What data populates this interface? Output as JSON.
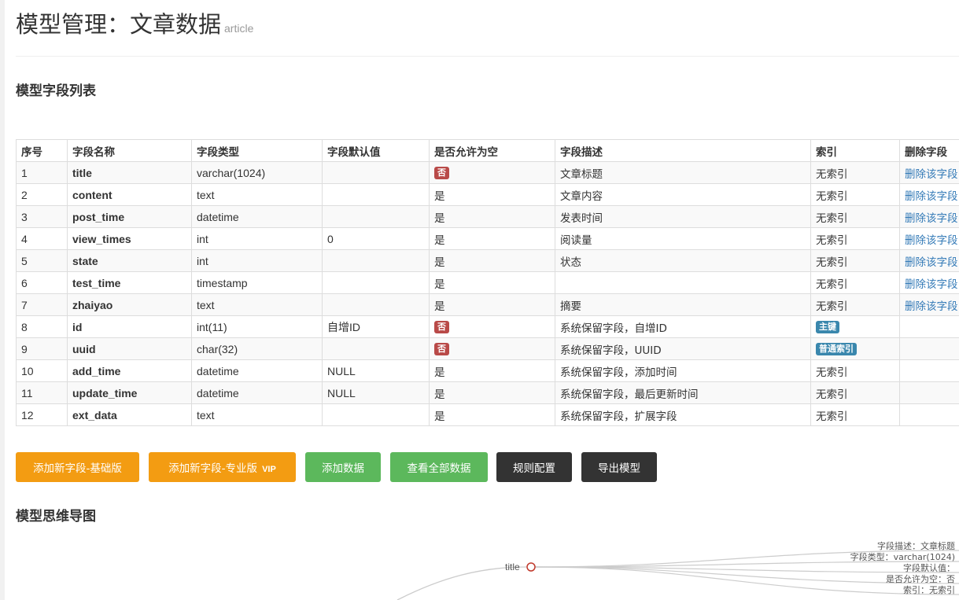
{
  "header": {
    "title": "模型管理：文章数据",
    "subtitle": "article"
  },
  "fields_section": {
    "title": "模型字段列表"
  },
  "table": {
    "columns": [
      "序号",
      "字段名称",
      "字段类型",
      "字段默认值",
      "是否允许为空",
      "字段描述",
      "索引",
      "删除字段"
    ],
    "rows": [
      {
        "no": "1",
        "name": "title",
        "type": "varchar(1024)",
        "default": "",
        "nullable": "否",
        "desc": "文章标题",
        "index": "无索引",
        "delete": "删除该字段"
      },
      {
        "no": "2",
        "name": "content",
        "type": "text",
        "default": "",
        "nullable": "是",
        "desc": "文章内容",
        "index": "无索引",
        "delete": "删除该字段"
      },
      {
        "no": "3",
        "name": "post_time",
        "type": "datetime",
        "default": "",
        "nullable": "是",
        "desc": "发表时间",
        "index": "无索引",
        "delete": "删除该字段"
      },
      {
        "no": "4",
        "name": "view_times",
        "type": "int",
        "default": "0",
        "nullable": "是",
        "desc": "阅读量",
        "index": "无索引",
        "delete": "删除该字段"
      },
      {
        "no": "5",
        "name": "state",
        "type": "int",
        "default": "",
        "nullable": "是",
        "desc": "状态",
        "index": "无索引",
        "delete": "删除该字段"
      },
      {
        "no": "6",
        "name": "test_time",
        "type": "timestamp",
        "default": "",
        "nullable": "是",
        "desc": "",
        "index": "无索引",
        "delete": "删除该字段"
      },
      {
        "no": "7",
        "name": "zhaiyao",
        "type": "text",
        "default": "",
        "nullable": "是",
        "desc": "摘要",
        "index": "无索引",
        "delete": "删除该字段"
      },
      {
        "no": "8",
        "name": "id",
        "type": "int(11)",
        "default": "自增ID",
        "nullable": "否",
        "desc": "系统保留字段，自增ID",
        "index": "主键",
        "delete": ""
      },
      {
        "no": "9",
        "name": "uuid",
        "type": "char(32)",
        "default": "",
        "nullable": "否",
        "desc": "系统保留字段，UUID",
        "index": "普通索引",
        "delete": ""
      },
      {
        "no": "10",
        "name": "add_time",
        "type": "datetime",
        "default": "NULL",
        "nullable": "是",
        "desc": "系统保留字段，添加时间",
        "index": "无索引",
        "delete": ""
      },
      {
        "no": "11",
        "name": "update_time",
        "type": "datetime",
        "default": "NULL",
        "nullable": "是",
        "desc": "系统保留字段，最后更新时间",
        "index": "无索引",
        "delete": ""
      },
      {
        "no": "12",
        "name": "ext_data",
        "type": "text",
        "default": "",
        "nullable": "是",
        "desc": "系统保留字段，扩展字段",
        "index": "无索引",
        "delete": ""
      }
    ]
  },
  "buttons": {
    "add_field_basic": "添加新字段-基础版",
    "add_field_pro": "添加新字段-专业版",
    "vip_badge": "VIP",
    "add_data": "添加数据",
    "view_all_data": "查看全部数据",
    "rule_config": "规则配置",
    "export_model": "导出模型"
  },
  "mindmap_section": {
    "title": "模型思维导图"
  },
  "mindmap": {
    "node_label": "title",
    "leaves": [
      "字段描述：文章标题",
      "字段类型：varchar(1024)",
      "字段默认值：",
      "是否允许为空：否",
      "索引：无索引"
    ]
  },
  "colors": {
    "orange": "#f39c12",
    "green": "#5cb85c",
    "dark": "#333333",
    "label_red": "#b94a48",
    "label_blue": "#3a87ad",
    "link_blue": "#337ab7",
    "mindmap_node": "#c0392b"
  }
}
